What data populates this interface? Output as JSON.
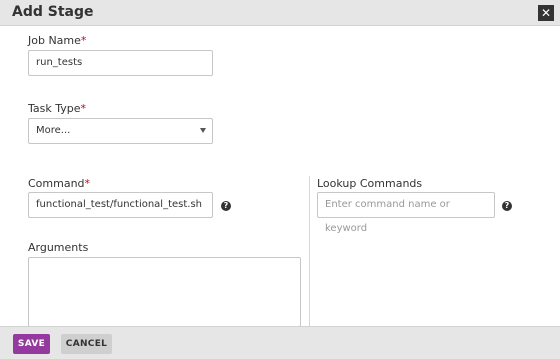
{
  "dialog": {
    "title": "Add Stage",
    "close_label": "✕"
  },
  "form": {
    "job_name": {
      "label": "Job Name",
      "required_mark": "*",
      "value": "run_tests"
    },
    "task_type": {
      "label": "Task Type",
      "required_mark": "*",
      "selected": "More..."
    },
    "command": {
      "label": "Command",
      "required_mark": "*",
      "value": "functional_test/functional_test.sh",
      "help_icon": "question-icon"
    },
    "lookup_commands": {
      "label": "Lookup Commands",
      "placeholder": "Enter command name or keyword",
      "help_icon": "question-icon"
    },
    "arguments": {
      "label": "Arguments",
      "value": ""
    }
  },
  "footer": {
    "save_label": "SAVE",
    "cancel_label": "CANCEL"
  },
  "colors": {
    "save_button": "#943a9e",
    "required_mark": "#d0021b"
  }
}
